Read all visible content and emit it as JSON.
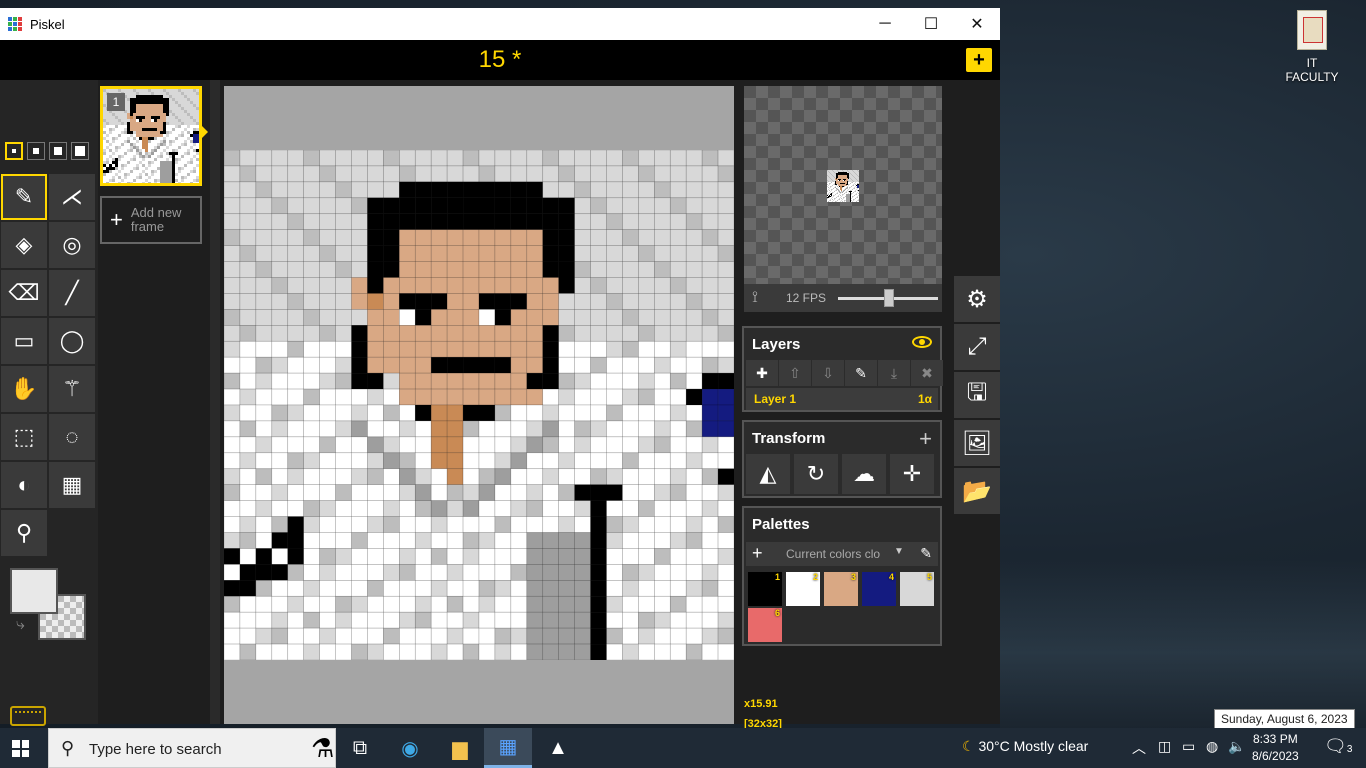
{
  "window": {
    "title": "Piskel"
  },
  "document": {
    "title": "15 *"
  },
  "frames": {
    "items": [
      {
        "number": "1"
      }
    ],
    "add_label_1": "Add new",
    "add_label_2": "frame"
  },
  "preview": {
    "fps_label": "12 FPS",
    "fps": 12
  },
  "layers": {
    "title": "Layers",
    "items": [
      {
        "name": "Layer 1",
        "opacity": "1α"
      }
    ]
  },
  "transform": {
    "title": "Transform"
  },
  "palettes": {
    "title": "Palettes",
    "selected": "Current colors clo",
    "swatches": [
      {
        "index": "1",
        "color": "#000000"
      },
      {
        "index": "2",
        "color": "#ffffff"
      },
      {
        "index": "3",
        "color": "#d9a884"
      },
      {
        "index": "4",
        "color": "#141b80"
      },
      {
        "index": "5",
        "color": "#d8d8d8"
      },
      {
        "index": "6",
        "color": "#e86a6a"
      }
    ]
  },
  "canvas": {
    "zoom": "x15.91",
    "size": "[32x32]"
  },
  "desktop": {
    "icon_label": "IT FACULTY"
  },
  "taskbar": {
    "search_placeholder": "Type here to search",
    "weather": "30°C  Mostly clear",
    "time": "8:33 PM",
    "date": "8/6/2023",
    "tooltip": "Sunday, August 6, 2023",
    "notifications": "3"
  },
  "colors": {
    "accent": "#ffd700",
    "panel": "#2b2b2b",
    "skin": "#d9a884",
    "hair": "#000000"
  }
}
